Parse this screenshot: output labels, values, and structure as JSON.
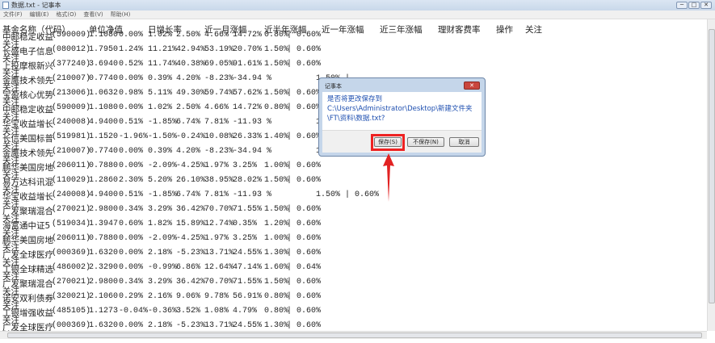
{
  "window": {
    "title": "数据.txt - 记事本",
    "controls": [
      "─",
      "□",
      "✕"
    ]
  },
  "menu": [
    "文件(F)",
    "编辑(E)",
    "格式(O)",
    "查看(V)",
    "帮助(H)"
  ],
  "header": {
    "name": "基金名称（代码）",
    "nav": "单位净值",
    "day": "日增长率",
    "month": "近一月涨幅",
    "half": "近半年涨幅",
    "year": "近一年涨幅",
    "three": "近三年涨幅",
    "fee": "理财客费率",
    "op": "操作",
    "follow": "关注"
  },
  "follow_label": "关注",
  "rows": [
    [
      "中邮稳定收益",
      "(590009)",
      "1.1080",
      "0.00%",
      "1.02%",
      "2.50%",
      "4.66%",
      "14.72%",
      "0.80%",
      "| 0.60%"
    ],
    [
      "长盛电子信息",
      "(080012)",
      "1.7950",
      "1.24%",
      "11.21%",
      "42.94%",
      "53.19%",
      "20.70%",
      "1.50%",
      "| 0.60%"
    ],
    [
      "上投摩根新兴",
      "(377240)",
      "3.6940",
      "0.52%",
      "11.74%",
      "40.38%",
      "69.05%",
      "91.61%",
      "1.50%",
      "| 0.60%"
    ],
    [
      "金鹰技术领先",
      "(210007)",
      "0.7740",
      "0.00%",
      "0.39%",
      "4.20%",
      "-8.23%",
      "-34.94 %",
      "",
      "      1.50% |"
    ],
    [
      "宝盈核心优势",
      "(213006)",
      "1.0632",
      "0.98%",
      "5.11%",
      "49.30%",
      "59.74%",
      "57.62%",
      "1.50%",
      "| 0.60%"
    ],
    [
      "中邮稳定收益",
      "(590009)",
      "1.1080",
      "0.00%",
      "1.02%",
      "2.50%",
      "4.66%",
      "14.72%",
      "0.80%",
      "| 0.60%"
    ],
    [
      "华宝收益增长",
      "(240008)",
      "4.9400",
      "0.51%",
      "-1.85%",
      "6.74%",
      "7.81%",
      "-11.93 %",
      "",
      "      1.50% |"
    ],
    [
      "长信美国标普",
      "(519981)",
      "1.1520",
      "-1.96%",
      "-1.50%",
      "-0.24%",
      "10.08%",
      "26.33%",
      "1.40%",
      "| 0.60%"
    ],
    [
      "金鹰技术领先",
      "(210007)",
      "0.7740",
      "0.00%",
      "0.39%",
      "4.20%",
      "-8.23%",
      "-34.94 %",
      "",
      "      1.50% |"
    ],
    [
      "鹏华美国房地",
      "(206011)",
      "0.7880",
      "0.00%",
      "-2.09%",
      "-4.25%",
      "1.97%",
      "3.25%",
      "1.00%",
      "| 0.60%"
    ],
    [
      "易方达科讯混",
      "(110029)",
      "1.2860",
      "2.30%",
      "5.20%",
      "26.10%",
      "38.95%",
      "28.02%",
      "1.50%",
      "| 0.60%"
    ],
    [
      "华宝收益增长",
      "(240008)",
      "4.9400",
      "0.51%",
      "-1.85%",
      "6.74%",
      "7.81%",
      "-11.93 %",
      "",
      "      1.50% | 0.60%"
    ],
    [
      "广发聚瑞混合",
      "(270021)",
      "2.9800",
      "0.34%",
      "3.29%",
      "36.42%",
      "70.70%",
      "71.55%",
      "1.50%",
      "| 0.60%"
    ],
    [
      "海富通中证5",
      "(519034)",
      "1.3947",
      "0.60%",
      "1.82%",
      "15.89%",
      "12.74%",
      "0.35%",
      "1.20%",
      "| 0.60%"
    ],
    [
      "鹏华美国房地",
      "(206011)",
      "0.7880",
      "0.00%",
      "-2.09%",
      "-4.25%",
      "1.97%",
      "3.25%",
      "1.00%",
      "| 0.60%"
    ],
    [
      "广发全球医疗",
      "(000369)",
      "1.6320",
      "0.00%",
      "2.18%",
      "-5.23%",
      "13.71%",
      "24.55%",
      "1.30%",
      "| 0.60%"
    ],
    [
      "工银全球精选",
      "(486002)",
      "2.3290",
      "0.00%",
      "-0.99%",
      "6.86%",
      "12.64%",
      "47.14%",
      "1.60%",
      "| 0.64%"
    ],
    [
      "广发聚瑞混合",
      "(270021)",
      "2.9800",
      "0.34%",
      "3.29%",
      "36.42%",
      "70.70%",
      "71.55%",
      "1.50%",
      "| 0.60%"
    ],
    [
      "诺安双利债券",
      "(320021)",
      "2.1060",
      "0.29%",
      "2.16%",
      "9.06%",
      "9.78%",
      "56.91%",
      "0.80%",
      "| 0.60%"
    ],
    [
      "工银增强收益",
      "(485105)",
      "1.1273",
      "-0.04%",
      "-0.36%",
      "3.52%",
      "1.08%",
      "4.79%",
      "0.80%",
      "| 0.60%"
    ],
    [
      "广发全球医疗",
      "(000369)",
      "1.6320",
      "0.00%",
      "2.18%",
      "-5.23%",
      "13.71%",
      "24.55%",
      "1.30%",
      "| 0.60%"
    ]
  ],
  "dialog": {
    "title": "记事本",
    "message": "是否将更改保存到 C:\\Users\\Administrator\\Desktop\\新建文件夹\\FT\\资料\\数据.txt?",
    "save": "保存(S)",
    "dont_save": "不保存(N)",
    "cancel": "取消",
    "close": "✕"
  },
  "colors": {
    "annotation": "#e22222",
    "dialog_text": "#1e4fb0"
  }
}
